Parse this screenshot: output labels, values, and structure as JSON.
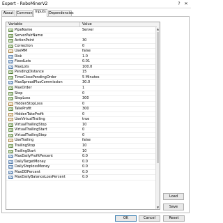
{
  "window": {
    "title": "Expert - RoboMinerV2",
    "help_label": "?",
    "close_label": "✕"
  },
  "tabs": [
    {
      "label": "About"
    },
    {
      "label": "Common"
    },
    {
      "label": "Inputs"
    },
    {
      "label": "Dependencies"
    }
  ],
  "grid": {
    "col_variable": "Variable",
    "col_value": "Value",
    "rows": [
      {
        "icon": "ab",
        "name": "PipeName",
        "value": "Server"
      },
      {
        "icon": "ab",
        "name": "ServerPairName",
        "value": ""
      },
      {
        "icon": "123",
        "name": "ActionPoint",
        "value": "30"
      },
      {
        "icon": "123",
        "name": "Correction",
        "value": "0"
      },
      {
        "icon": "bool",
        "name": "UseMM",
        "value": "false"
      },
      {
        "icon": "v2",
        "name": "Risk",
        "value": "1.0"
      },
      {
        "icon": "v2",
        "name": "FixedLots",
        "value": "0.01"
      },
      {
        "icon": "v2",
        "name": "MaxLots",
        "value": "100.0"
      },
      {
        "icon": "123",
        "name": "PendingDistance",
        "value": "15"
      },
      {
        "icon": "123",
        "name": "TimeClosePendingOrder",
        "value": "5 Minutes"
      },
      {
        "icon": "v2",
        "name": "MaxSpreadPlusCommission",
        "value": "30.0"
      },
      {
        "icon": "123",
        "name": "MaxOrder",
        "value": "1"
      },
      {
        "icon": "123",
        "name": "Stop",
        "value": "0"
      },
      {
        "icon": "123",
        "name": "StopLoss",
        "value": "300"
      },
      {
        "icon": "bool",
        "name": "HiddenStopLoss",
        "value": "0"
      },
      {
        "icon": "123",
        "name": "TakeProfit",
        "value": "300"
      },
      {
        "icon": "bool",
        "name": "HiddenTakeProfit",
        "value": "0"
      },
      {
        "icon": "bool",
        "name": "UseVirtualTrailing",
        "value": "true"
      },
      {
        "icon": "123",
        "name": "VirtualTrailingStop",
        "value": "10"
      },
      {
        "icon": "123",
        "name": "VirtualTrailingStart",
        "value": "0"
      },
      {
        "icon": "123",
        "name": "VirtualTrailingStep",
        "value": "0"
      },
      {
        "icon": "bool",
        "name": "UseTrailing",
        "value": "false"
      },
      {
        "icon": "123",
        "name": "TrailingStop",
        "value": "10"
      },
      {
        "icon": "123",
        "name": "TrailingStart",
        "value": "10"
      },
      {
        "icon": "v2",
        "name": "MaxDailyProfitPercent",
        "value": "0.0"
      },
      {
        "icon": "v2",
        "name": "DailyTargetMoney",
        "value": "0.0"
      },
      {
        "icon": "v2",
        "name": "DailyStoplossMoney",
        "value": "0.0"
      },
      {
        "icon": "v2",
        "name": "MaxDDPercent",
        "value": "0.0"
      },
      {
        "icon": "v2",
        "name": "MaxDailyBalanceLossPercent",
        "value": "0.0"
      }
    ]
  },
  "buttons": {
    "load": "Load",
    "save": "Save",
    "ok": "OK",
    "cancel": "Cancel",
    "reset": "Reset"
  },
  "icons": {
    "string": "ab",
    "integer": "123",
    "double": "v2",
    "boolean": "bool"
  },
  "colors": {
    "ok_border": "#3c7fb1"
  }
}
